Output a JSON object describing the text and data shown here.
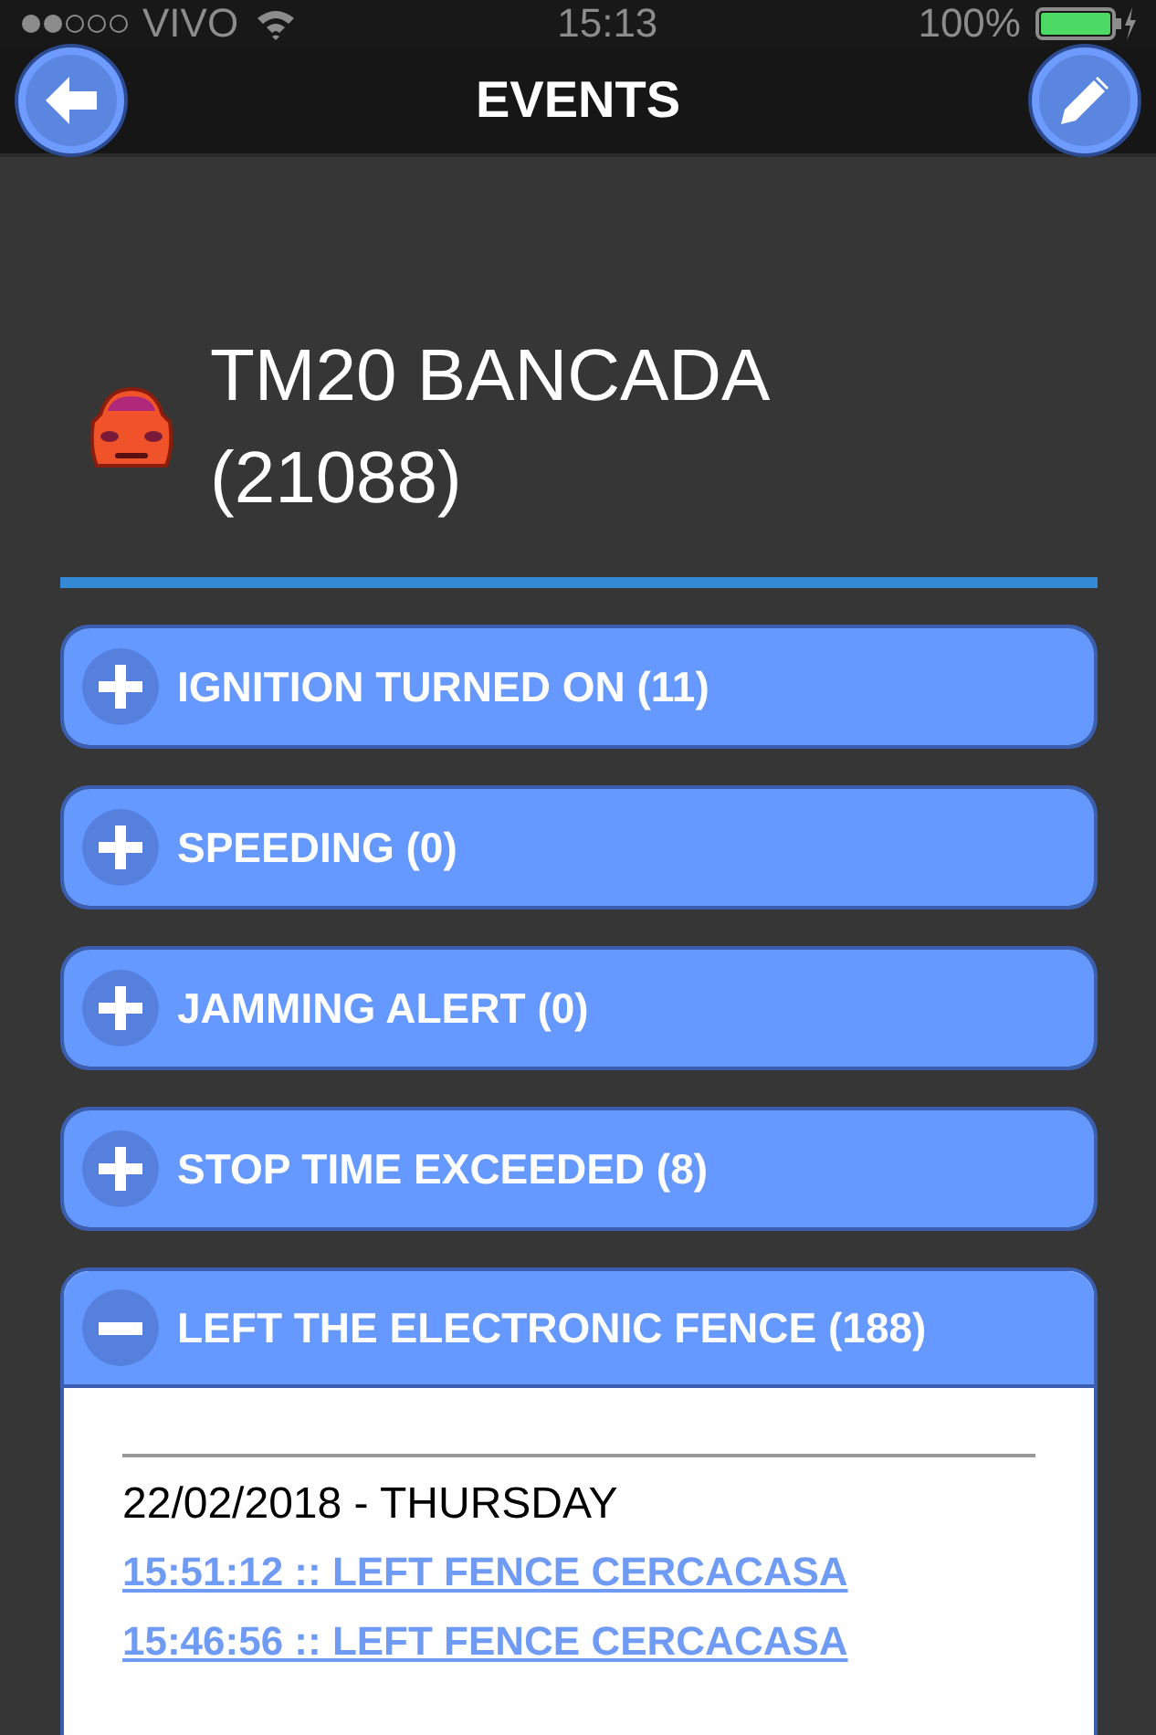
{
  "status_bar": {
    "carrier": "VIVO",
    "time": "15:13",
    "battery": "100%"
  },
  "header": {
    "title": "EVENTS"
  },
  "vehicle": {
    "name": "TM20 BANCADA",
    "id": "(21088)"
  },
  "events": [
    {
      "label": "IGNITION TURNED ON (11)",
      "expanded": false
    },
    {
      "label": "SPEEDING (0)",
      "expanded": false
    },
    {
      "label": "JAMMING ALERT (0)",
      "expanded": false
    },
    {
      "label": "STOP TIME EXCEEDED (8)",
      "expanded": false
    },
    {
      "label": "LEFT THE ELECTRONIC FENCE (188)",
      "expanded": true,
      "days": [
        {
          "date": "22/02/2018 - THURSDAY",
          "entries": [
            "15:51:12 :: LEFT FENCE CERCACASA",
            "15:46:56 :: LEFT FENCE CERCACASA"
          ]
        }
      ]
    }
  ]
}
